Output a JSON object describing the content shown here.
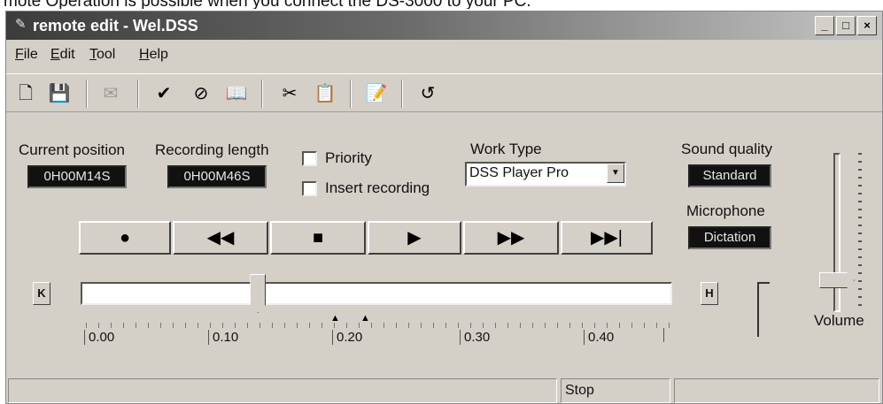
{
  "caption": "mote Operation is possible when you connect the DS-3000 to your PC.",
  "window": {
    "title": "remote edit - Wel.DSS",
    "controls": {
      "minimize": "_",
      "maximize": "□",
      "close": "×"
    }
  },
  "menu": [
    {
      "label": "File",
      "mnemonic": "F",
      "rest": "ile"
    },
    {
      "label": "Edit",
      "mnemonic": "E",
      "rest": "dit"
    },
    {
      "label": "Tool",
      "mnemonic": "T",
      "rest": "ool"
    },
    {
      "label": "Help",
      "mnemonic": "H",
      "rest": "elp"
    }
  ],
  "toolbar": {
    "icons": [
      "new-file-icon",
      "save-icon",
      "mail-icon",
      "check-icon",
      "finish-icon",
      "book-icon",
      "cut-icon",
      "paste-icon",
      "properties-icon",
      "undo-icon"
    ],
    "glyphs": [
      "🗋",
      "💾",
      "✉",
      "✔",
      "⊘",
      "📖",
      "✂",
      "📋",
      "📝",
      "↺"
    ],
    "disabled": [
      "mail-icon",
      "paste-icon"
    ]
  },
  "position": {
    "label": "Current position",
    "value": "0H00M14S"
  },
  "length": {
    "label": "Recording length",
    "value": "0H00M46S"
  },
  "options": {
    "priority_label": "Priority",
    "insert_label": "Insert recording"
  },
  "work_type": {
    "label": "Work Type",
    "value": "DSS Player Pro",
    "arrow": "▼"
  },
  "sound_quality": {
    "label": "Sound quality",
    "value": "Standard"
  },
  "microphone": {
    "label": "Microphone",
    "value": "Dictation"
  },
  "transport": {
    "record": "●",
    "rewind": "◀◀",
    "stop": "■",
    "play": "▶",
    "fast_forward": "▶▶",
    "next": "▶▶|"
  },
  "timeline": {
    "start_marker": "K",
    "end_marker": "H",
    "ticks": [
      "0.00",
      "0.10",
      "0.20",
      "0.30",
      "0.40"
    ],
    "marker_glyph": "▲",
    "progress": 0.3
  },
  "volume": {
    "label": "Volume",
    "level": 0.2
  },
  "status": {
    "panel1": "",
    "panel2": "Stop",
    "panel3": ""
  }
}
